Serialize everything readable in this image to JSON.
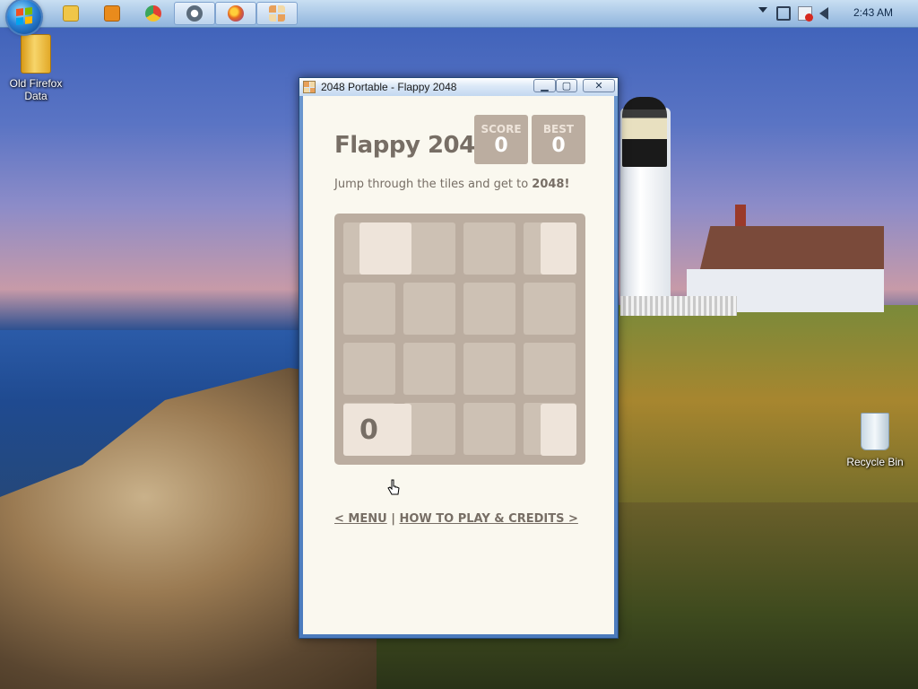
{
  "taskbar": {
    "items": [
      {
        "name": "explorer",
        "color": "#f0c648"
      },
      {
        "name": "media-player",
        "color": "#e98b1c"
      },
      {
        "name": "chrome",
        "color": "#e44134"
      },
      {
        "name": "app-4",
        "color": "#5b6b7b"
      },
      {
        "name": "firefox",
        "color": "#e66a1f"
      },
      {
        "name": "2048-portable",
        "color": "#e8a05a"
      }
    ],
    "clock": "2:43 AM"
  },
  "desktop": {
    "icons": [
      {
        "label": "Old Firefox Data"
      },
      {
        "label": "Recycle Bin"
      }
    ]
  },
  "window": {
    "title": "2048 Portable - Flappy 2048",
    "controls": {
      "minimize": "▁",
      "maximize": "▢",
      "close": "✕"
    }
  },
  "game": {
    "title": "Flappy 2048",
    "score_label": "SCORE",
    "score_value": "0",
    "best_label": "BEST",
    "best_value": "0",
    "intro_prefix": "Jump through the tiles and get to ",
    "intro_bold": "2048!",
    "bird_value": "0",
    "menu_link": "< MENU",
    "separator": "|",
    "credits_link": "HOW TO PLAY & CREDITS >",
    "colors": {
      "background": "#faf8ef",
      "board": "#bbada0",
      "cell": "#cdc1b4",
      "tile": "#eee4da",
      "text": "#776e65"
    }
  }
}
